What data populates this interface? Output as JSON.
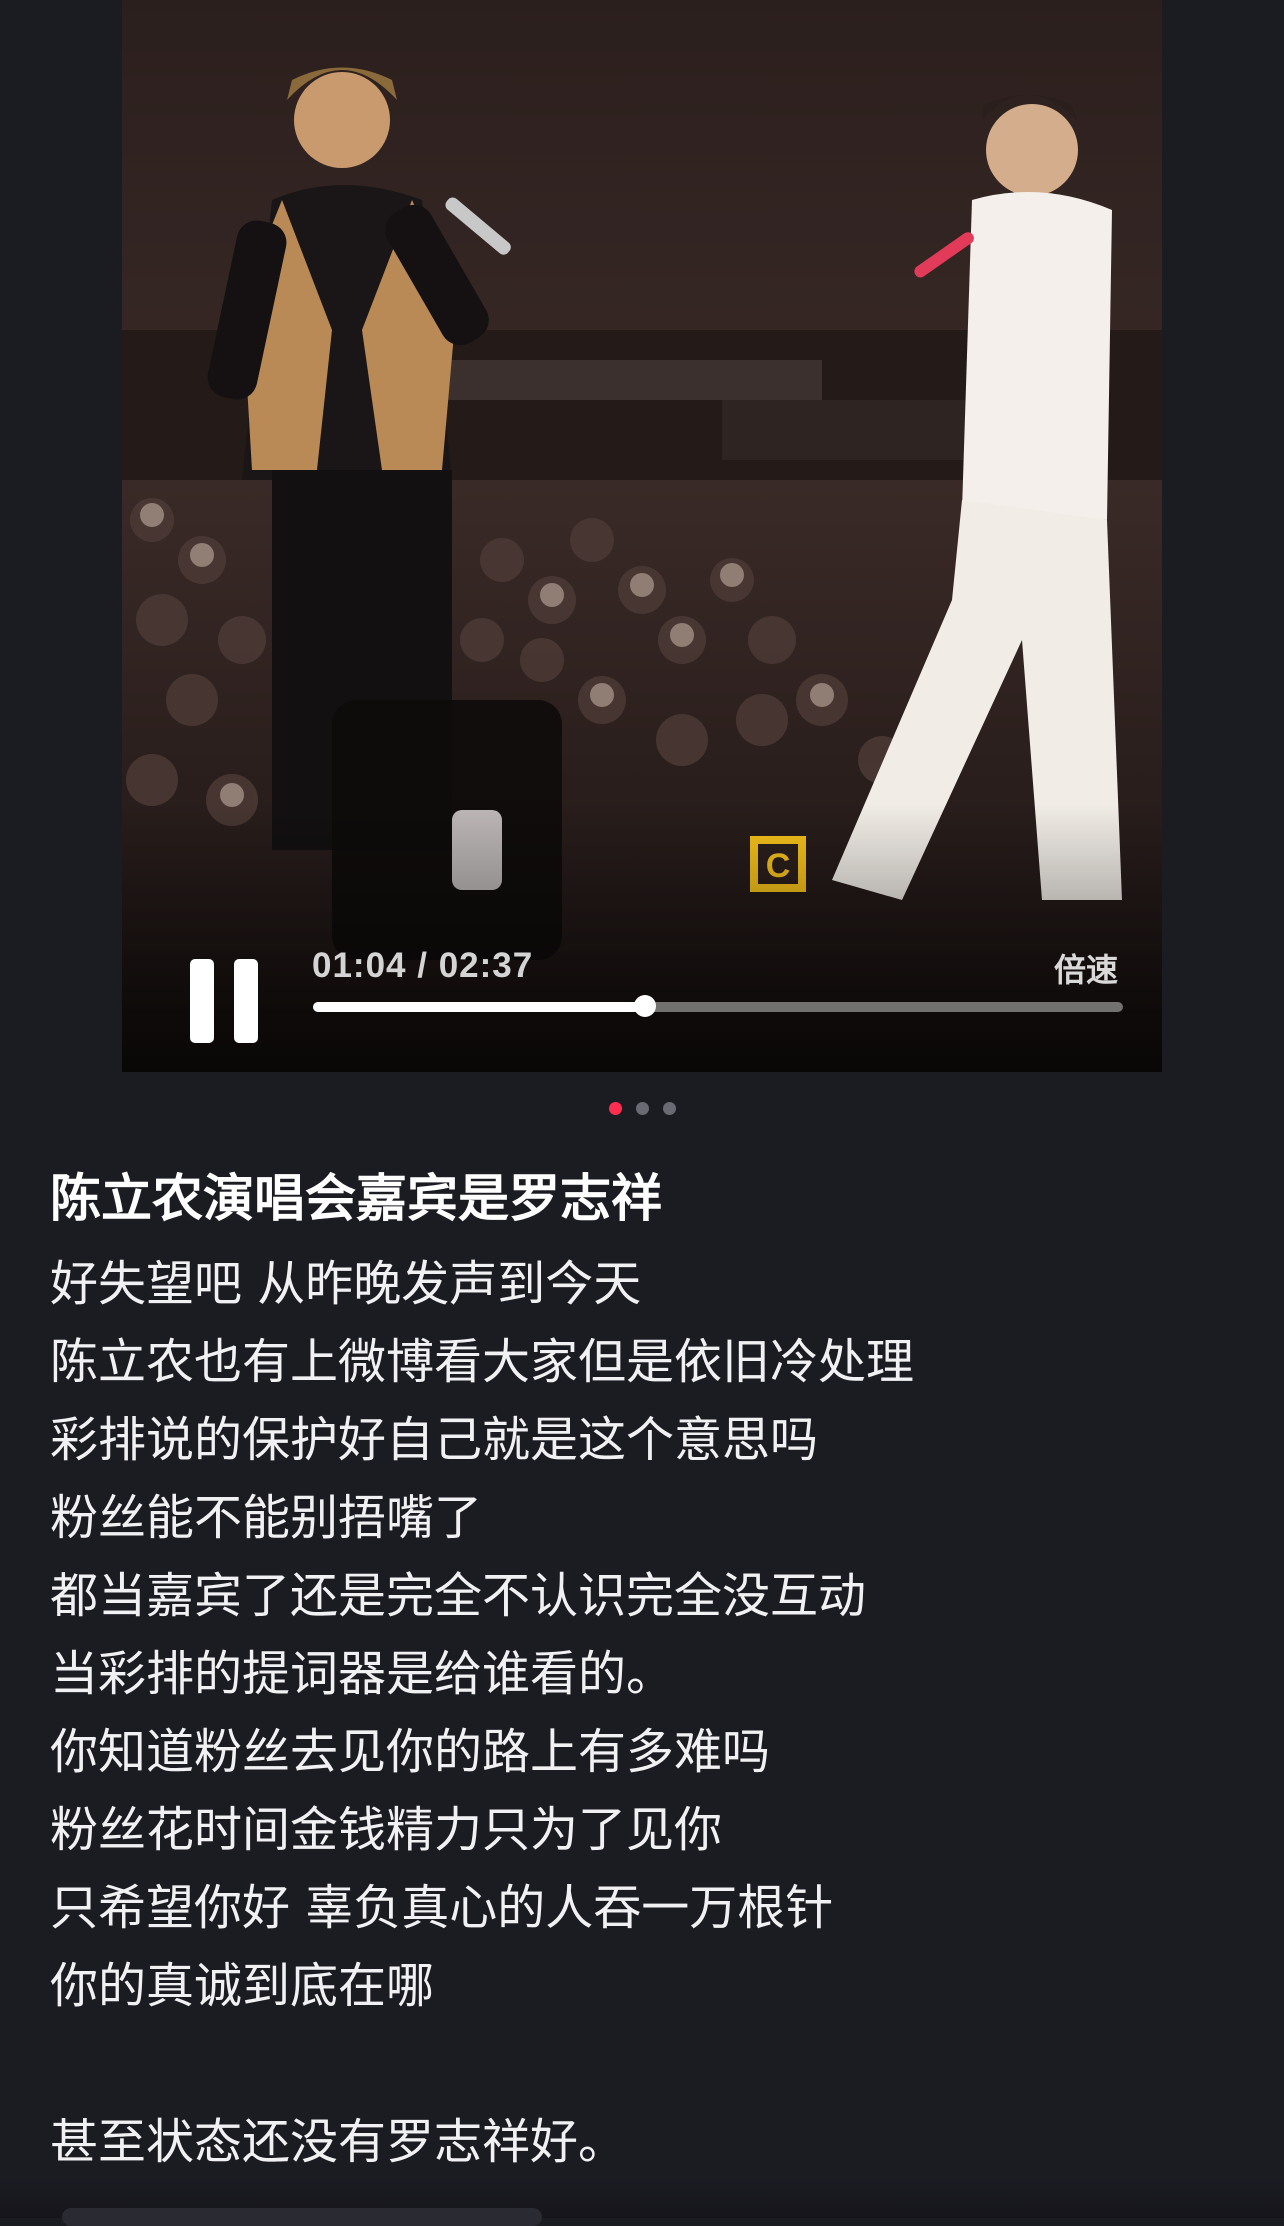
{
  "player": {
    "time_display": "01:04 / 02:37",
    "speed_label": "倍速",
    "progress_fraction": 0.41,
    "state": "playing",
    "stage_logo_text": "C"
  },
  "carousel": {
    "count": 3,
    "active_index": 0,
    "active_color": "#ff2d4f"
  },
  "post": {
    "title": "陈立农演唱会嘉宾是罗志祥",
    "lines": [
      "好失望吧 从昨晚发声到今天",
      "陈立农也有上微博看大家但是依旧冷处理",
      "彩排说的保护好自己就是这个意思吗",
      "粉丝能不能别捂嘴了",
      "都当嘉宾了还是完全不认识完全没互动",
      "当彩排的提词器是给谁看的。",
      "你知道粉丝去见你的路上有多难吗",
      "粉丝花时间金钱精力只为了见你",
      "只希望你好 辜负真心的人吞一万根针",
      "你的真诚到底在哪",
      "",
      "甚至状态还没有罗志祥好。"
    ]
  },
  "colors": {
    "background": "#1b1b22",
    "text": "#f1f1f3",
    "accent": "#ff2d4f"
  }
}
